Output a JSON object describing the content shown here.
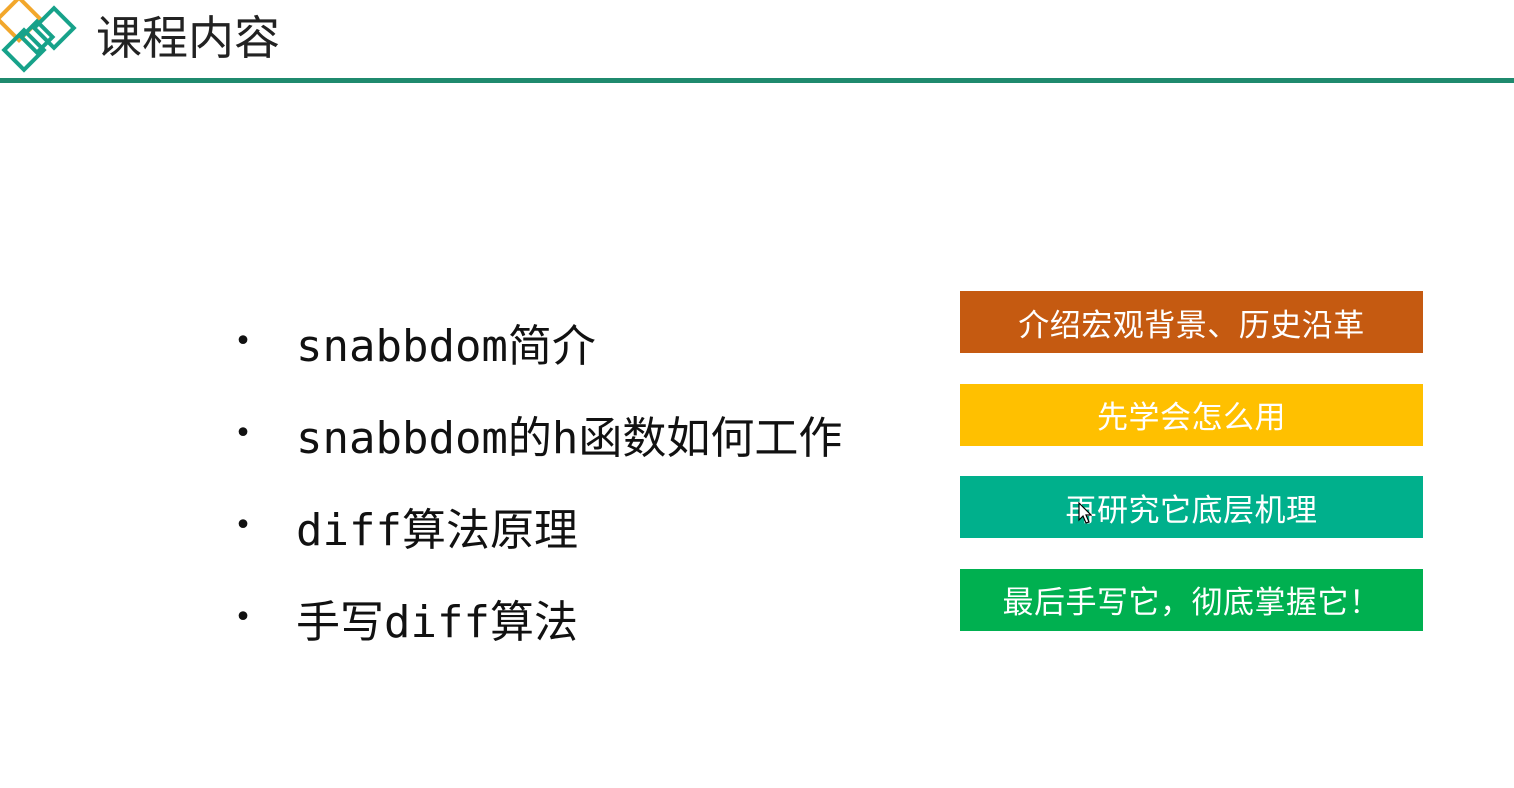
{
  "header": {
    "title": "课程内容",
    "logo_colors": [
      "#f2a72c",
      "#17a28a",
      "#17a28a",
      "#17a28a"
    ],
    "rule_color": "#1f8a6e"
  },
  "bullets": {
    "marker": "•",
    "items": [
      "snabbdom简介",
      "snabbdom的h函数如何工作",
      "diff算法原理",
      "手写diff算法"
    ]
  },
  "tags": [
    {
      "label": "介绍宏观背景、历史沿革",
      "color": "#c55a11"
    },
    {
      "label": "先学会怎么用",
      "color": "#ffc000"
    },
    {
      "label": "再研究它底层机理",
      "color": "#00b08c"
    },
    {
      "label": "最后手写它，彻底掌握它！",
      "color": "#00b050"
    }
  ]
}
